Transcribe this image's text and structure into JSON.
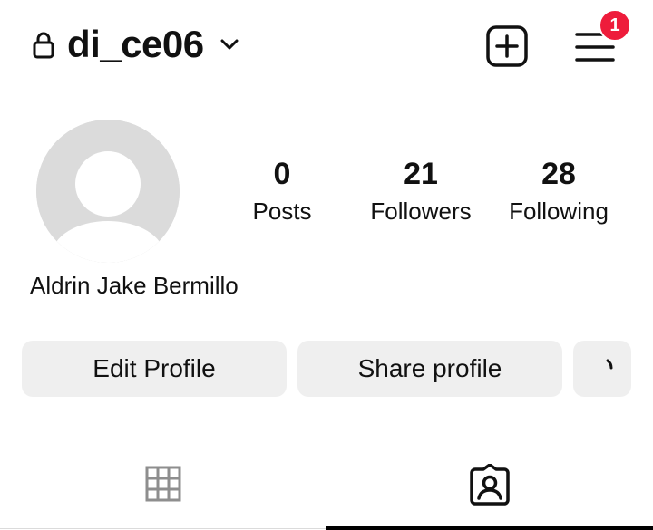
{
  "header": {
    "username": "di_ce06",
    "notification_count": "1",
    "icons": {
      "lock": "lock-icon",
      "chevron": "chevron-down-icon",
      "create": "plus-square-icon",
      "menu": "hamburger-menu-icon"
    }
  },
  "profile": {
    "full_name": "Aldrin Jake Bermillo",
    "avatar": "default-avatar-icon"
  },
  "stats": {
    "posts": {
      "value": "0",
      "label": "Posts"
    },
    "followers": {
      "value": "21",
      "label": "Followers"
    },
    "following": {
      "value": "28",
      "label": "Following"
    }
  },
  "buttons": {
    "edit_profile": "Edit Profile",
    "share_profile": "Share profile",
    "more_icon": "loading-spinner-icon"
  },
  "tabs": [
    {
      "name": "posts-grid",
      "icon": "grid-icon",
      "active": false
    },
    {
      "name": "tagged",
      "icon": "tagged-person-icon",
      "active": true
    }
  ],
  "colors": {
    "badge": "#ee1c3b",
    "button_bg": "#efefef",
    "avatar_bg": "#dbdbdb",
    "text": "#111111",
    "inactive_icon": "#8e8e8e"
  }
}
